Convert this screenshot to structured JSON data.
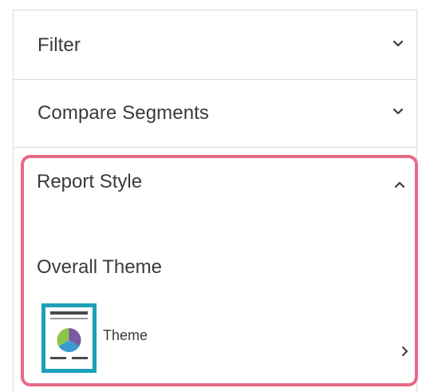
{
  "sections": {
    "filter": {
      "title": "Filter",
      "state": "collapsed"
    },
    "compare": {
      "title": "Compare Segments",
      "state": "collapsed"
    },
    "report_style": {
      "title": "Report Style",
      "state": "expanded",
      "subsection_title": "Overall Theme",
      "theme_item": {
        "label": "Theme"
      }
    }
  },
  "icons": {
    "filter_toggle": "chevron-down-icon",
    "compare_toggle": "chevron-down-icon",
    "report_style_toggle": "chevron-up-icon",
    "theme_open": "chevron-right-icon",
    "theme_thumbnail": "theme-thumbnail-icon"
  },
  "colors": {
    "highlight_border": "#e86a86",
    "thumbnail_frame": "#1ea0b8",
    "pie_purple": "#7a5aa6",
    "pie_green": "#8fc34a",
    "pie_blue": "#3a9bd0",
    "text": "#3a3a3a"
  }
}
